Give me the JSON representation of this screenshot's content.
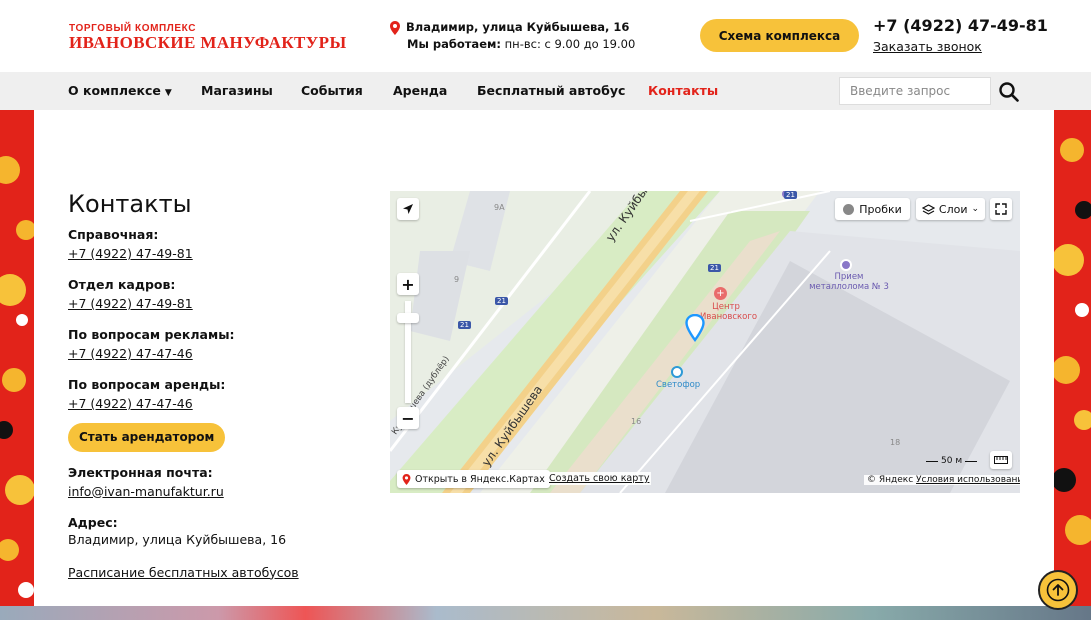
{
  "header": {
    "logo_top": "ТОРГОВЫЙ КОМПЛЕКС",
    "logo_main": "ИВАНОВСКИЕ МАНУФАКТУРЫ",
    "address": "Владимир, улица Куйбышева, 16",
    "hours_label": "Мы работаем:",
    "hours_value": " пн-вс: с 9.00 до 19.00",
    "scheme_button": "Схема комплекса",
    "phone": "+7 (4922) 47-49-81",
    "callback_link": "Заказать звонок",
    "accent_color": "#e2231a",
    "button_color": "#f7c23a"
  },
  "nav": {
    "items": [
      {
        "label": "О комплексе"
      },
      {
        "label": "Магазины"
      },
      {
        "label": "События"
      },
      {
        "label": "Аренда"
      },
      {
        "label": "Бесплатный автобус"
      },
      {
        "label": "Контакты"
      }
    ],
    "active": "Контакты",
    "search_placeholder": "Введите запрос"
  },
  "contacts": {
    "title": "Контакты",
    "groups": [
      {
        "label": "Справочная:",
        "value": "+7 (4922) 47-49-81"
      },
      {
        "label": "Отдел кадров:",
        "value": "+7 (4922) 47-49-81"
      },
      {
        "label": "По вопросам рекламы:",
        "value": "+7 (4922) 47-47-46"
      },
      {
        "label": "По вопросам аренды:",
        "value": "+7 (4922) 47-47-46"
      }
    ],
    "tenant_button": "Стать арендатором",
    "email_label": "Электронная почта:",
    "email": "info@ivan-manufaktur.ru",
    "address_label": "Адрес:",
    "address": "Владимир, улица Куйбышева, 16",
    "bus_link": "Расписание бесплатных автобусов"
  },
  "map": {
    "traffic_button": "Пробки",
    "layers_button": "Слои",
    "street_label_1": "ул. Куйбышева",
    "street_label_2": "ул. Куйбышева",
    "street_label_3": "Куйбышева (дублёр)",
    "poi_center": "Центр",
    "poi_center_2": "Ивановского",
    "poi_svetofor": "Светофор",
    "poi_scrap": "Прием",
    "poi_scrap_2": "металлолома № 3",
    "house_9a": "9А",
    "house_9": "9",
    "house_16": "16",
    "house_18": "18",
    "bus_stop_1": "21",
    "bus_stop_2": "21",
    "bus_stop_3": "21",
    "bus_stop_4": "21",
    "scale": "50 м",
    "open_yandex": "Открыть в Яндекс.Картах",
    "create_map": "Создать свою карту",
    "copyright": "© Яндекс",
    "terms": "Условия использования",
    "icons": [
      "geolocation-icon",
      "zoom-in-icon",
      "zoom-out-icon",
      "traffic-icon",
      "layers-icon",
      "fullscreen-icon",
      "ruler-icon",
      "map-pin-icon"
    ]
  }
}
